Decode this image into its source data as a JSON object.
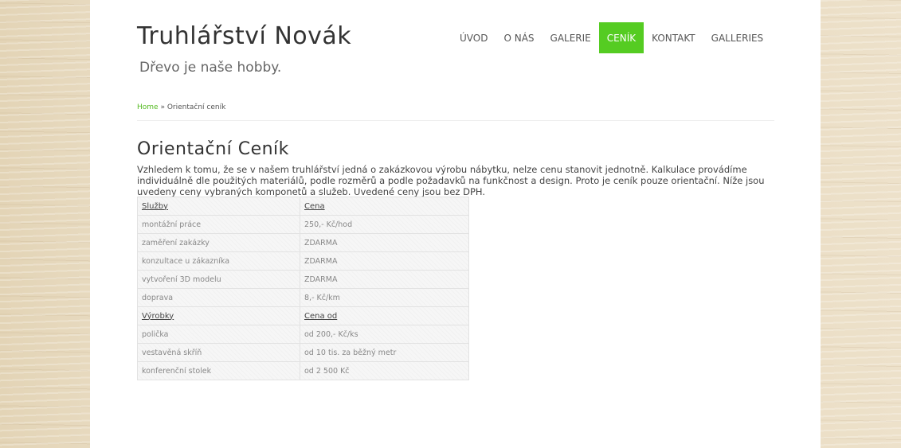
{
  "site": {
    "title": "Truhlářství Novák",
    "tagline": "Dřevo je naše hobby."
  },
  "nav": {
    "items": [
      {
        "label": "ÚVOD",
        "active": false
      },
      {
        "label": "O NÁS",
        "active": false
      },
      {
        "label": "GALERIE",
        "active": false
      },
      {
        "label": "CENÍK",
        "active": true
      },
      {
        "label": "KONTAKT",
        "active": false
      },
      {
        "label": "GALLERIES",
        "active": false
      }
    ],
    "active_color": "#55cc22"
  },
  "breadcrumb": {
    "home": "Home",
    "separator": " » ",
    "current": "Orientační ceník"
  },
  "page": {
    "heading": "Orientační Ceník",
    "intro": "Vzhledem k tomu, že se v našem truhlářství jedná o zakázkovou výrobu nábytku, nelze cenu stanovit jednotně. Kalkulace provádíme individuálně dle použitých materiálů, podle rozměrů a podle požadavků na funkčnost a design. Proto je ceník pouze orientační. Níže jsou uvedeny ceny vybraných komponetů a služeb. Uvedené ceny jsou bez DPH."
  },
  "price_table": {
    "rows": [
      {
        "name": "Služby",
        "price": "Cena",
        "header": true
      },
      {
        "name": "montážní práce",
        "price": "250,- Kč/hod",
        "header": false
      },
      {
        "name": "zaměření zakázky",
        "price": "ZDARMA",
        "header": false
      },
      {
        "name": "konzultace u zákazníka",
        "price": "ZDARMA",
        "header": false
      },
      {
        "name": "vytvoření 3D modelu",
        "price": "ZDARMA",
        "header": false
      },
      {
        "name": "doprava",
        "price": "8,- Kč/km",
        "header": false
      },
      {
        "name": "Výrobky",
        "price": "Cena od",
        "header": true
      },
      {
        "name": "polička",
        "price": "od 200,- Kč/ks",
        "header": false
      },
      {
        "name": "vestavěná skříň",
        "price": "od 10 tis. za běžný metr",
        "header": false
      },
      {
        "name": "konferenční stolek",
        "price": "od 2 500 Kč",
        "header": false
      }
    ]
  }
}
